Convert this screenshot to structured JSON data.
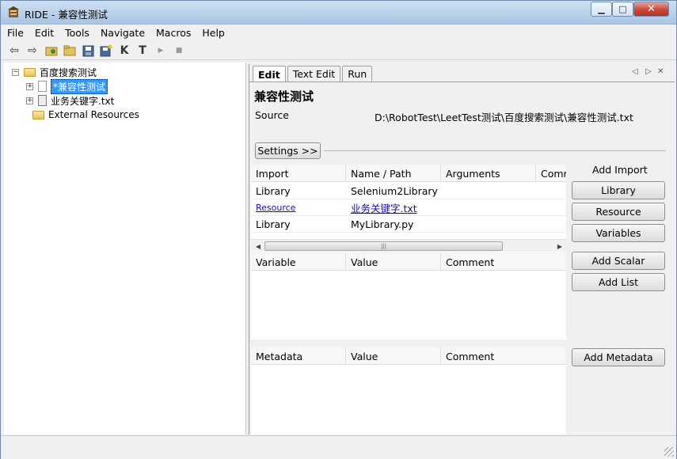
{
  "window": {
    "title": "RIDE - 兼容性测试",
    "min_glyph": "▁",
    "max_glyph": "□",
    "close_glyph": "✕"
  },
  "menu": [
    "File",
    "Edit",
    "Tools",
    "Navigate",
    "Macros",
    "Help"
  ],
  "toolbar": {
    "icons": [
      "back-arrow-icon",
      "forward-arrow-icon",
      "open-project-icon",
      "open-folder-icon",
      "save-icon",
      "save-all-icon",
      "keyword-search-icon",
      "test-search-icon",
      "run-icon",
      "stop-icon"
    ],
    "glyphs": [
      "⇦",
      "⇨",
      "",
      "",
      "",
      "",
      "K",
      "T",
      "▶",
      "■"
    ]
  },
  "tree": {
    "root": "百度搜索测试",
    "items": [
      "*兼容性测试",
      "业务关键字.txt"
    ],
    "external": "External Resources",
    "expander": "−",
    "collapsed": "+"
  },
  "tabs": [
    "Edit",
    "Text Edit",
    "Run"
  ],
  "tab_nav": [
    "◁",
    "▷",
    "✕"
  ],
  "editor": {
    "title": "兼容性测试",
    "source_label": "Source",
    "source_value": "D:\\RobotTest\\LeetTest测试\\百度搜索测试\\兼容性测试.txt",
    "settings_button": "Settings >>"
  },
  "import_table": {
    "columns": [
      "Import",
      "Name / Path",
      "Arguments",
      "Comm"
    ],
    "rows": [
      {
        "type": "Library",
        "name": "Selenium2Library",
        "link": false
      },
      {
        "type": "Resource",
        "name": "业务关键字.txt",
        "link": true
      },
      {
        "type": "Library",
        "name": "MyLibrary.py",
        "link": false
      }
    ],
    "scroll_thumb": "|||",
    "scroll_left": "◀",
    "scroll_right": "▶"
  },
  "import_side": {
    "label": "Add Import",
    "buttons": [
      "Library",
      "Resource",
      "Variables"
    ]
  },
  "variable_table": {
    "columns": [
      "Variable",
      "Value",
      "Comment"
    ]
  },
  "variable_side": {
    "buttons": [
      "Add Scalar",
      "Add List"
    ]
  },
  "metadata_table": {
    "columns": [
      "Metadata",
      "Value",
      "Comment"
    ]
  },
  "metadata_side": {
    "buttons": [
      "Add Metadata"
    ]
  }
}
